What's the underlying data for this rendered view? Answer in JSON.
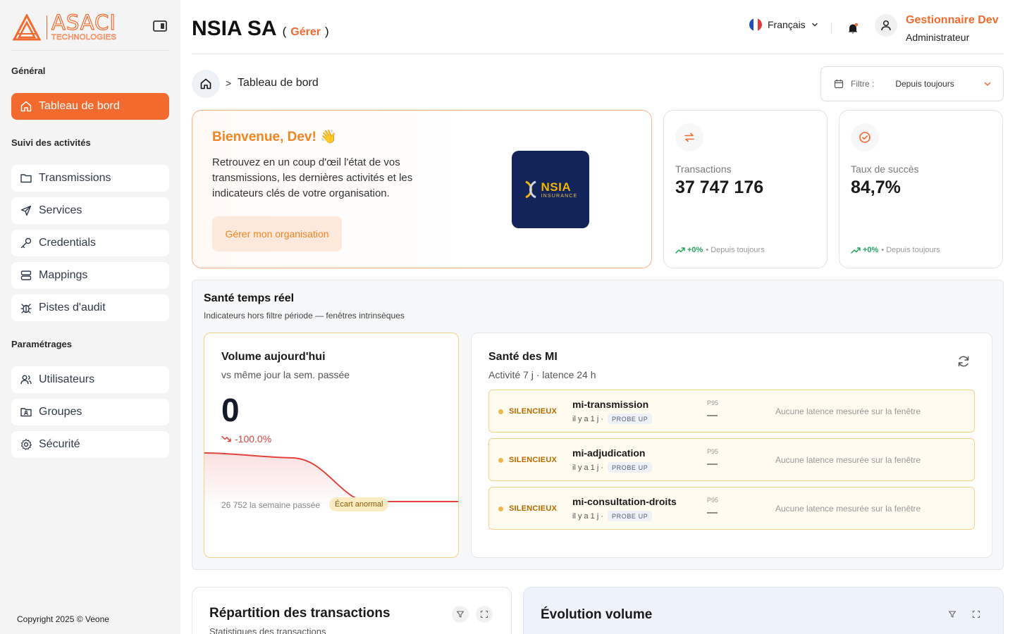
{
  "brand": {
    "name": "ASACI",
    "tagline": "TECHNOLOGIES"
  },
  "colors": {
    "accent": "#f26a2e",
    "warning": "#f1b948",
    "danger": "#e0443c",
    "success": "#22a45d",
    "partner_bg": "#13245a"
  },
  "sidebar": {
    "sections": [
      {
        "title": "Général"
      },
      {
        "title": "Suivi des activités"
      },
      {
        "title": "Paramétrages"
      }
    ],
    "items": [
      {
        "label": "Tableau de bord",
        "icon": "home-icon",
        "active": true
      },
      {
        "label": "Transmissions",
        "icon": "folder-icon"
      },
      {
        "label": "Services",
        "icon": "send-icon"
      },
      {
        "label": "Credentials",
        "icon": "key-icon"
      },
      {
        "label": "Mappings",
        "icon": "server-icon"
      },
      {
        "label": "Pistes d'audit",
        "icon": "bug-icon"
      },
      {
        "label": "Utilisateurs",
        "icon": "users-icon"
      },
      {
        "label": "Groupes",
        "icon": "group-folder-icon"
      },
      {
        "label": "Sécurité",
        "icon": "gear-icon"
      }
    ],
    "copyright": "Copyright 2025 © Veone"
  },
  "header": {
    "org": "NSIA SA",
    "paren_open": "(",
    "manage": "Gérer",
    "paren_close": ")",
    "language": "Français",
    "user_name": "Gestionnaire Dev",
    "user_role": "Administrateur"
  },
  "breadcrumb": {
    "sep": ">",
    "current": "Tableau de bord"
  },
  "filter": {
    "label": "Filtre :",
    "value": "Depuis toujours"
  },
  "welcome": {
    "title": "Bienvenue, Dev! 👋",
    "text": "Retrouvez en un coup d'œil l'état de vos transmissions, les dernières activités et les indicateurs clés de votre organisation.",
    "button": "Gérer mon organisation",
    "partner_logo": {
      "name": "NSIA",
      "sub": "INSURANCE"
    }
  },
  "kpis": [
    {
      "label": "Transactions",
      "value": "37 747 176",
      "trend": "+0%",
      "period": "• Depuis toujours",
      "icon": "arrows-exchange-icon"
    },
    {
      "label": "Taux de succès",
      "value": "84,7%",
      "trend": "+0%",
      "period": "• Depuis toujours",
      "icon": "check-circle-icon"
    }
  ],
  "health": {
    "title": "Santé temps réel",
    "subtitle": "Indicateurs hors filtre période — fenêtres intrinsèques",
    "volume": {
      "title": "Volume aujourd'hui",
      "subtitle": "vs même jour la sem. passée",
      "value": "0",
      "delta": "-100.0%",
      "last_week": "26 752 la semaine passée",
      "badge": "Écart anormal"
    },
    "mi": {
      "title": "Santé des MI",
      "subtitle": "Activité 7 j · latence 24 h",
      "rows": [
        {
          "status": "SILENCIEUX",
          "name": "mi-transmission",
          "ago": "il y a 1 j ·",
          "probe": "PROBE UP",
          "p95_label": "P95",
          "p95": "—",
          "note": "Aucune latence mesurée sur la fenêtre"
        },
        {
          "status": "SILENCIEUX",
          "name": "mi-adjudication",
          "ago": "il y a 1 j ·",
          "probe": "PROBE UP",
          "p95_label": "P95",
          "p95": "—",
          "note": "Aucune latence mesurée sur la fenêtre"
        },
        {
          "status": "SILENCIEUX",
          "name": "mi-consultation-droits",
          "ago": "il y a 1 j ·",
          "probe": "PROBE UP",
          "p95_label": "P95",
          "p95": "—",
          "note": "Aucune latence mesurée sur la fenêtre"
        }
      ]
    }
  },
  "bottom": {
    "left": {
      "title": "Répartition des transactions",
      "subtitle": "Statistiques des transactions"
    },
    "right": {
      "title": "Évolution volume"
    }
  }
}
